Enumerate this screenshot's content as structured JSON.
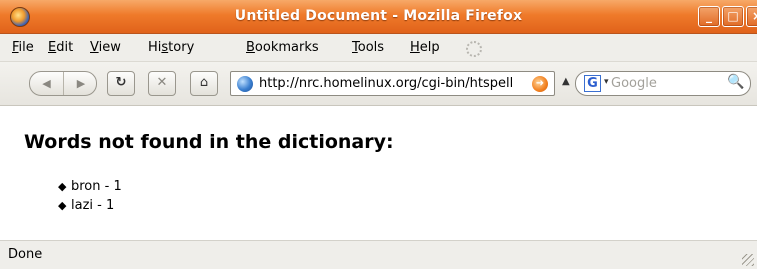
{
  "window": {
    "title": "Untitled Document - Mozilla Firefox",
    "controls": {
      "minimize": "_",
      "maximize": "□",
      "close": "×"
    }
  },
  "menu": {
    "items": [
      {
        "key": "F",
        "rest": "ile"
      },
      {
        "key": "E",
        "rest": "dit"
      },
      {
        "key": "V",
        "rest": "iew"
      },
      {
        "pre": "Hi",
        "key": "s",
        "rest": "tory"
      },
      {
        "key": "B",
        "rest": "ookmarks"
      },
      {
        "key": "T",
        "rest": "ools"
      },
      {
        "key": "H",
        "rest": "elp"
      }
    ]
  },
  "navigation": {
    "back_icon": "◀",
    "forward_icon": "▶",
    "reload_icon": "↻",
    "stop_icon": "✕",
    "home_icon": "⌂",
    "url": "http://nrc.homelinux.org/cgi-bin/htspell",
    "history_dropdown": "▲",
    "search_engine": "G",
    "search_engine_dropdown": "▾",
    "search_placeholder": "Google",
    "search_icon": "🔍"
  },
  "page": {
    "heading": "Words not found in the dictionary:",
    "bullet": "◆",
    "words": [
      "bron - 1",
      "lazi - 1"
    ]
  },
  "status": {
    "text": "Done"
  }
}
